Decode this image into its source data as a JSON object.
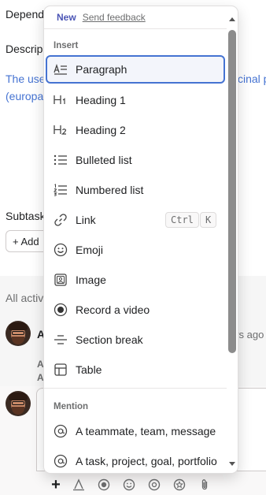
{
  "background": {
    "dependencies_label": "Depend",
    "description_label": "Descrip",
    "description_text_line1": "The use",
    "description_text_right": "cinal p",
    "description_text_line2": "(europa",
    "subtasks_label": "Subtask",
    "add_subtask_label": "Add",
    "all_activity_label": "All activ",
    "comment_author_initial": "A",
    "comment_time": "ys ago",
    "comment_line1": "A",
    "comment_line2": "A"
  },
  "menu": {
    "new_badge": "New",
    "feedback_link": "Send feedback",
    "insert_section": "Insert",
    "insert_items": [
      {
        "label": "Paragraph",
        "icon": "paragraph-icon"
      },
      {
        "label": "Heading 1",
        "icon": "heading1-icon"
      },
      {
        "label": "Heading 2",
        "icon": "heading2-icon"
      },
      {
        "label": "Bulleted list",
        "icon": "bulleted-list-icon"
      },
      {
        "label": "Numbered list",
        "icon": "numbered-list-icon"
      },
      {
        "label": "Link",
        "icon": "link-icon",
        "shortcut": [
          "Ctrl",
          "K"
        ]
      },
      {
        "label": "Emoji",
        "icon": "emoji-icon"
      },
      {
        "label": "Image",
        "icon": "image-icon"
      },
      {
        "label": "Record a video",
        "icon": "record-icon"
      },
      {
        "label": "Section break",
        "icon": "section-break-icon"
      },
      {
        "label": "Table",
        "icon": "table-icon"
      }
    ],
    "mention_section": "Mention",
    "mention_items": [
      {
        "label": "A teammate, team, message",
        "icon": "at-icon"
      },
      {
        "label": "A task, project, goal, portfolio",
        "icon": "at-icon"
      }
    ],
    "selected_item": "Paragraph"
  },
  "toolbar": {
    "icons": [
      "plus-icon",
      "text-format-icon",
      "record-icon",
      "emoji-icon",
      "mention-icon",
      "star-icon",
      "attachment-icon"
    ]
  },
  "colors": {
    "accent": "#4573d2",
    "new_badge": "#4b55b5",
    "text": "#1e1f21",
    "muted": "#6d6e6f"
  }
}
